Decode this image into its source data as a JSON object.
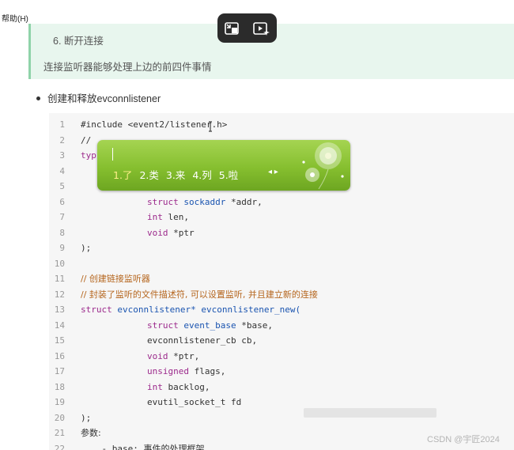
{
  "menu": {
    "help": "帮助(H)"
  },
  "callout": {
    "title": "6.  断开连接",
    "description": "连接监听器能够处理上边的前四件事情"
  },
  "pip_controls": {
    "icons": [
      "pip-exit-icon",
      "play-ai-icon"
    ]
  },
  "bullet": {
    "text": "创建和释放evconnlistener"
  },
  "code": {
    "line_numbers": [
      "1",
      "2",
      "3",
      "4",
      "5",
      "6",
      "7",
      "8",
      "9",
      "10",
      "11",
      "12",
      "13",
      "14",
      "15",
      "16",
      "17",
      "18",
      "19",
      "20",
      "21",
      "22"
    ],
    "l1": "#include <event2/listener.h>",
    "l2": "//",
    "l3": "typ",
    "l6": [
      "struct",
      " sockaddr ",
      "*addr,"
    ],
    "l7": [
      "int",
      " len,"
    ],
    "l8": [
      "void",
      " *ptr"
    ],
    "l9": ");",
    "l11": "// 创建链接监听器",
    "l12": "// 封装了监听的文件描述符, 可以设置监听, 并且建立新的连接",
    "l13": [
      "struct",
      " evconnlistener* ",
      "evconnlistener_new("
    ],
    "l14": [
      "struct",
      " event_base ",
      "*base,"
    ],
    "l15": "evconnlistener_cb cb,",
    "l16": [
      "void",
      " *ptr,"
    ],
    "l17": [
      "unsigned",
      " flags,"
    ],
    "l18": [
      "int",
      " backlog,"
    ],
    "l19": "evutil_socket_t fd",
    "l20": ");",
    "l21": "参数:",
    "l22": [
      "    - base: ",
      "事件的处理框架"
    ]
  },
  "ime": {
    "candidates": [
      "1.了",
      "2.类",
      "3.来",
      "4.列",
      "5.啦"
    ],
    "nav_arrows": "◂ ▸",
    "decoration": "dandelion-icon"
  },
  "watermark": "CSDN @宇匠2024"
}
